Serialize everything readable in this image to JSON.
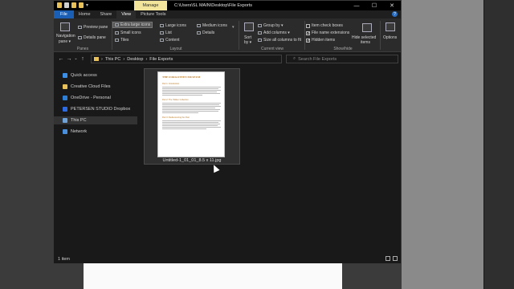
{
  "window": {
    "title": "C:\\Users\\SL MAIN\\Desktop\\File Exports",
    "manage_label": "Manage",
    "min_glyph": "—",
    "max_glyph": "☐",
    "close_glyph": "✕"
  },
  "tabs": {
    "file": "File",
    "home": "Home",
    "share": "Share",
    "view": "View",
    "picture_tools": "Picture Tools",
    "help": "?"
  },
  "ribbon": {
    "panes": {
      "label": "Panes",
      "navigation_pane": "Navigation",
      "navigation_pane_2": "pane ▾",
      "preview_pane": "Preview pane",
      "details_pane": "Details pane"
    },
    "layout": {
      "label": "Layout",
      "extra_large_icons": "Extra large icons",
      "large_icons": "Large icons",
      "medium_icons": "Medium icons",
      "small_icons": "Small icons",
      "list": "List",
      "details": "Details",
      "tiles": "Tiles",
      "content": "Content"
    },
    "current_view": {
      "label": "Current view",
      "sort_by": "Sort",
      "sort_by_2": "by ▾",
      "group_by": "Group by ▾",
      "add_columns": "Add columns ▾",
      "size_all_columns": "Size all columns to fit"
    },
    "show_hide": {
      "label": "Show/hide",
      "item_check_boxes": "Item check boxes",
      "file_name_extensions": "File name extensions",
      "hidden_items": "Hidden items",
      "hide_selected": "Hide selected",
      "hide_selected_2": "items",
      "item_check_boxes_checked": false,
      "file_name_extensions_checked": true,
      "hidden_items_checked": true
    },
    "options": "Options"
  },
  "nav": {
    "back": "←",
    "forward": "→",
    "recent": "⌄",
    "up": "↑",
    "path": [
      "This PC",
      "Desktop",
      "File Exports"
    ],
    "sep": "›",
    "search_placeholder": "Search File Exports"
  },
  "sidebar": {
    "items": [
      {
        "label": "Quick access",
        "color": "#3c8ee6"
      },
      {
        "label": "Creative Cloud Files",
        "color": "#e8c15a"
      },
      {
        "label": "OneDrive - Personal",
        "color": "#2f7fd6"
      },
      {
        "label": "PETERSEN STUDIO Dropbox",
        "color": "#2f6be0"
      },
      {
        "label": "This PC",
        "color": "#6fa3d8"
      },
      {
        "label": "Network",
        "color": "#4a8fdc"
      }
    ]
  },
  "content": {
    "file_name": "Untitled-1_01_01_8.5 x 11.jpg",
    "thumbnail": {
      "title": "THE FORGOTTEN MUSEUM",
      "section_1": "Part 1: Introduction",
      "section_2": "Part 2: The Hidden Collection",
      "section_3": "Part 3: Rediscovering the Past"
    }
  },
  "status": {
    "item_count": "1 item"
  }
}
